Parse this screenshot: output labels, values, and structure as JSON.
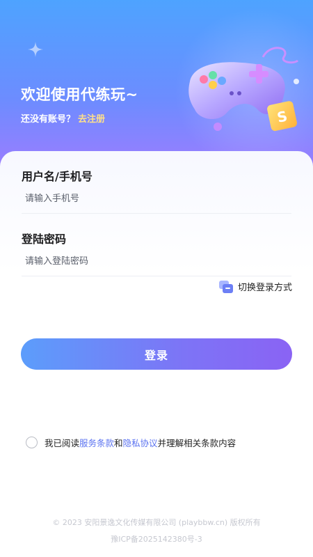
{
  "hero": {
    "welcome_text": "欢迎使用代练玩~",
    "no_account_text": "还没有账号？",
    "register_link": "去注册"
  },
  "form": {
    "username_label": "用户名/手机号",
    "username_placeholder": "请输入手机号",
    "password_label": "登陆密码",
    "password_placeholder": "请输入登陆密码",
    "switch_login_label": "切换登录方式",
    "login_button": "登录"
  },
  "agreement": {
    "prefix": "我已阅读",
    "terms_link": "服务条款",
    "and": "和",
    "privacy_link": "隐私协议",
    "suffix": "并理解相关条款内容",
    "checked": false
  },
  "footer": {
    "copyright": "© 2023 安阳景逸文化传媒有限公司 (playbbw.cn) 版权所有",
    "icp": "豫ICP备2025142380号-3"
  },
  "colors": {
    "accent_start": "#5c9dfb",
    "accent_end": "#8a63f4",
    "link": "#5b73f0",
    "register_link": "#ffe08a"
  }
}
